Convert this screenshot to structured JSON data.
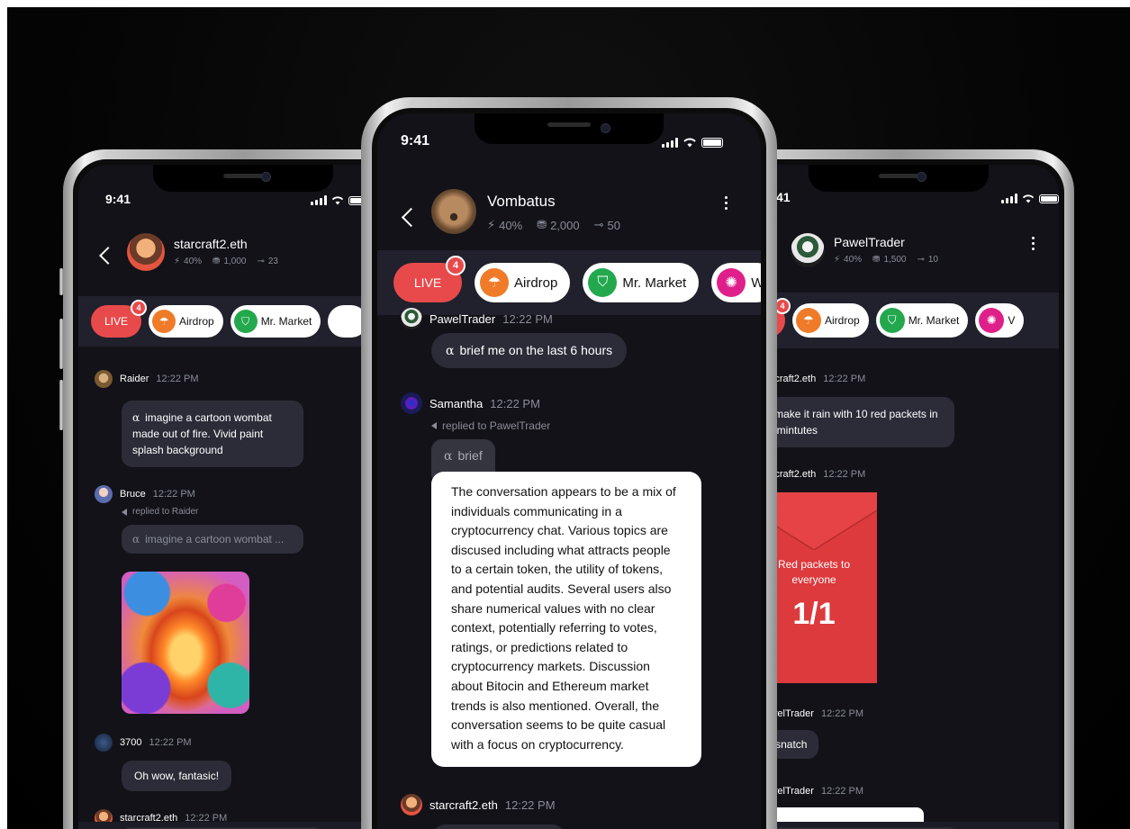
{
  "shared": {
    "status_time": "9:41",
    "chips": {
      "live": "LIVE",
      "live_count": "4",
      "airdrop": "Airdrop",
      "mr_market": "Mr. Market",
      "third_center": "W",
      "third_right": "V"
    },
    "colors": {
      "live_red": "#e84a4c",
      "chip_row_bg": "#20212c",
      "screen_bg": "#121218",
      "bubble_bg": "#2b2c38",
      "airdrop_orange": "#ef7b28",
      "market_green": "#23a84d",
      "third_pink": "#e0208a"
    }
  },
  "left_phone": {
    "username": "starcraft2.eth",
    "stats": {
      "energy": "40%",
      "coins": "1,000",
      "keys": "23"
    },
    "messages": [
      {
        "name": "Raider",
        "time": "12:22 PM",
        "text": "imagine a cartoon wombat made out of fire. Vivid paint splash background"
      },
      {
        "name": "Bruce",
        "time": "12:22 PM",
        "reply_to": "replied to Raider",
        "text": "imagine a cartoon wombat ..."
      },
      {
        "name": "3700",
        "time": "12:22 PM",
        "text": "Oh wow, fantasic!"
      },
      {
        "name": "starcraft2.eth",
        "time": "12:22 PM"
      }
    ]
  },
  "center_phone": {
    "username": "Vombatus",
    "stats": {
      "energy": "40%",
      "coins": "2,000",
      "keys": "50"
    },
    "messages": [
      {
        "name": "PawelTrader",
        "time": "12:22 PM",
        "text": "brief me on the last 6 hours"
      },
      {
        "name": "Samantha",
        "time": "12:22 PM",
        "reply_to": "replied to PawelTrader",
        "text": "brief"
      },
      {
        "name": "starcraft2.eth",
        "time": "12:22 PM"
      }
    ],
    "summary": "The conversation appears to be a mix of individuals communicating in a cryptocurrency chat. Various topics are discused including what attracts people to a certain token, the utility of tokens, and potential audits. Several users also share numerical values with no clear context, potentially referring to votes, ratings, or predictions related to cryptocurrency markets. Discussion about Bitocin and Ethereum market trends is also mentioned. Overall, the conversation seems to be quite casual with a focus on cryptocurrency."
  },
  "right_phone": {
    "status_time": "41",
    "username": "PawelTrader",
    "stats": {
      "energy": "40%",
      "coins": "1,500",
      "keys": "10"
    },
    "messages": [
      {
        "name": "starcraft2.eth",
        "time": "12:22 PM",
        "text": "make it rain with 10 red packets in 30 mintutes"
      },
      {
        "name": "starcraft2.eth",
        "time": "12:22 PM"
      },
      {
        "name": "PawelTrader",
        "time": "12:22 PM",
        "text": "snatch"
      },
      {
        "name": "PawelTrader",
        "time": "12:22 PM"
      }
    ],
    "red_packet": {
      "title": "Red packets to everyone",
      "count": "1/1"
    }
  }
}
